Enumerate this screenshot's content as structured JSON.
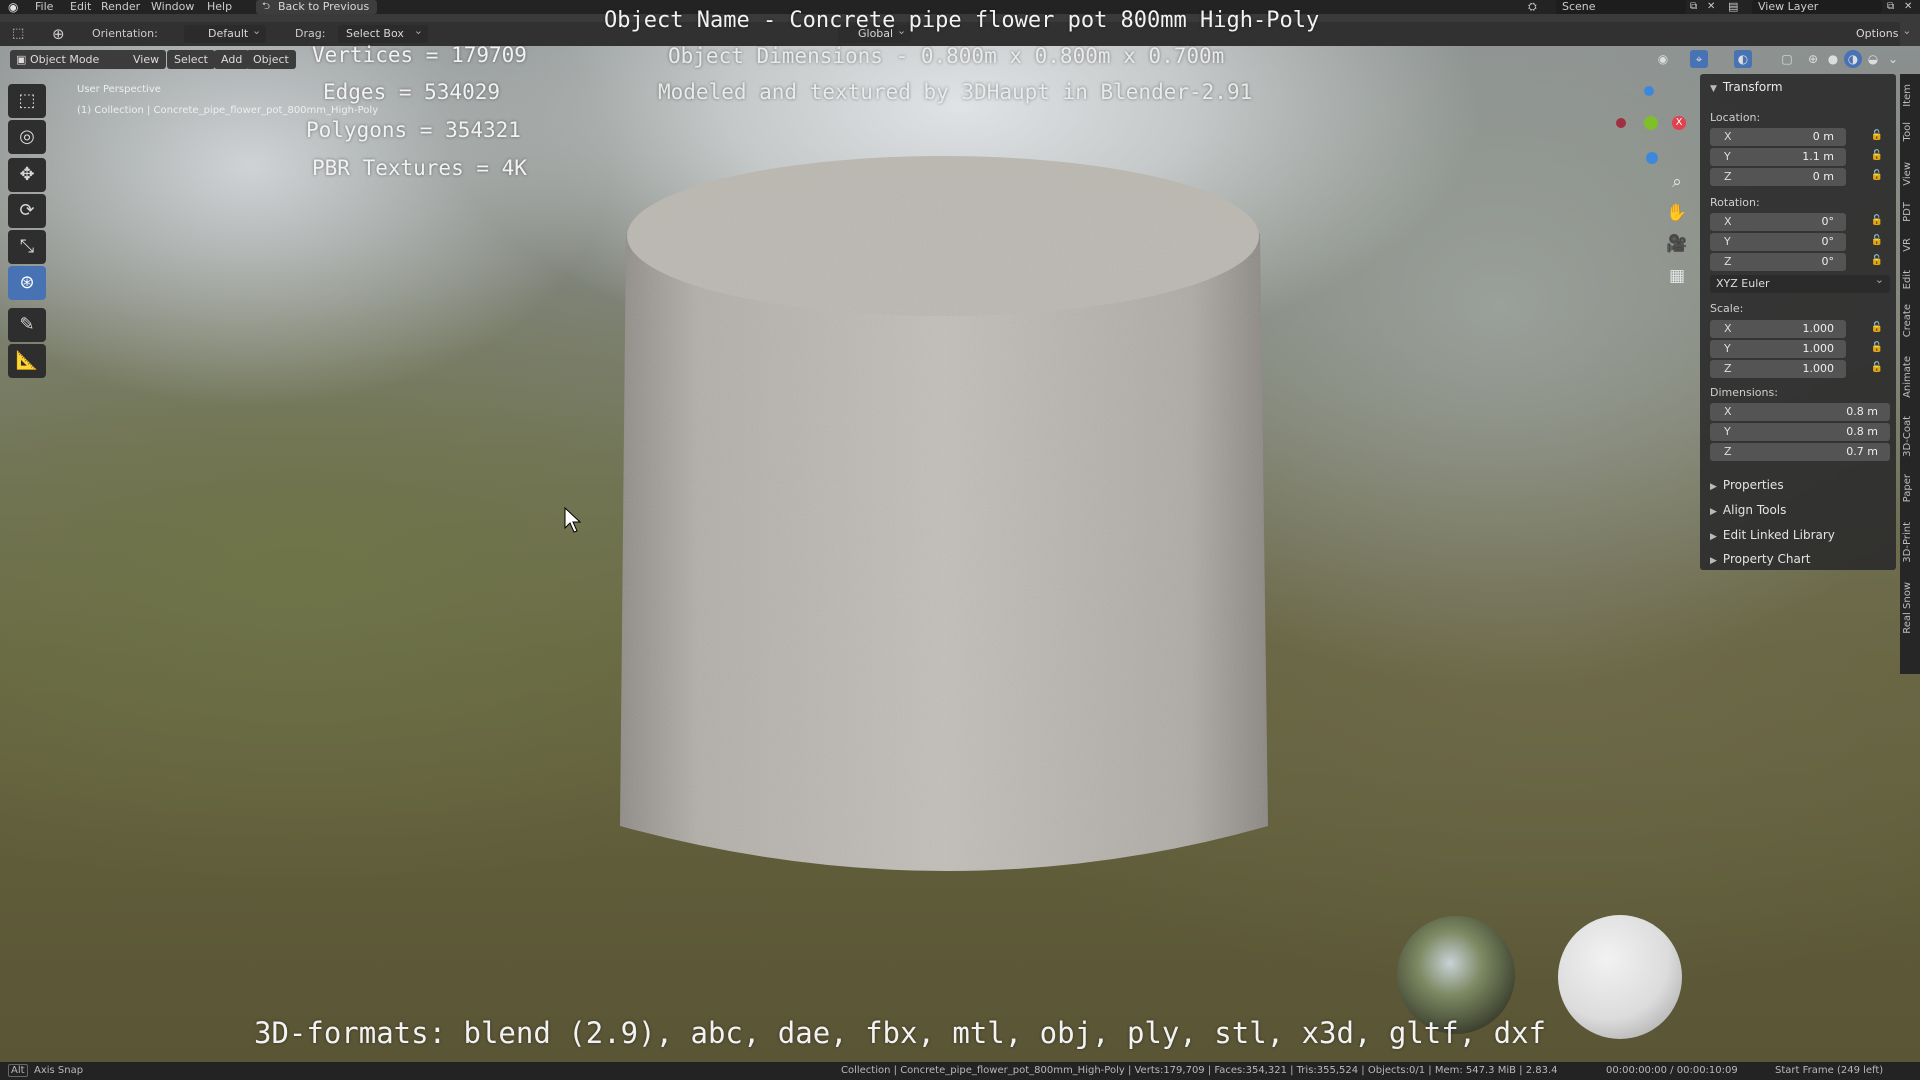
{
  "menubar": {
    "items": [
      "File",
      "Edit",
      "Render",
      "Window",
      "Help"
    ],
    "back_button": "Back to Previous",
    "scene": "Scene",
    "view_layer": "View Layer"
  },
  "toolheader": {
    "orientation_label": "Orientation:",
    "orientation_value": "Default",
    "drag_label": "Drag:",
    "drag_value": "Select Box",
    "transform_space": "Global",
    "options": "Options"
  },
  "viewport_header": {
    "mode": "Object Mode",
    "menus": [
      "View",
      "Select",
      "Add",
      "Object"
    ]
  },
  "viewport": {
    "perspective": "User Perspective",
    "collection_path": "(1) Collection | Concrete_pipe_flower_pot_800mm_High-Poly"
  },
  "overlay": {
    "title": "Object Name - Concrete pipe flower pot 800mm High-Poly",
    "dimensions": "Object Dimensions -  0.800m x 0.800m x 0.700m",
    "modeled_by": "Modeled and textured by 3DHaupt in Blender-2.91",
    "vertices": "Vertices = 179709",
    "edges": "Edges = 534029",
    "polygons": "Polygons = 354321",
    "textures": "PBR Textures = 4K",
    "formats": "3D-formats: blend (2.9), abc, dae, fbx, mtl, obj, ply, stl, x3d, gltf, dxf"
  },
  "npanel": {
    "transform_header": "Transform",
    "location_label": "Location:",
    "location": [
      {
        "axis": "X",
        "value": "0 m"
      },
      {
        "axis": "Y",
        "value": "1.1 m"
      },
      {
        "axis": "Z",
        "value": "0 m"
      }
    ],
    "rotation_label": "Rotation:",
    "rotation": [
      {
        "axis": "X",
        "value": "0°"
      },
      {
        "axis": "Y",
        "value": "0°"
      },
      {
        "axis": "Z",
        "value": "0°"
      }
    ],
    "rotation_mode": "XYZ Euler",
    "scale_label": "Scale:",
    "scale": [
      {
        "axis": "X",
        "value": "1.000"
      },
      {
        "axis": "Y",
        "value": "1.000"
      },
      {
        "axis": "Z",
        "value": "1.000"
      }
    ],
    "dimensions_label": "Dimensions:",
    "dimensions": [
      {
        "axis": "X",
        "value": "0.8 m"
      },
      {
        "axis": "Y",
        "value": "0.8 m"
      },
      {
        "axis": "Z",
        "value": "0.7 m"
      }
    ],
    "collapsed_panels": [
      "Properties",
      "Align Tools",
      "Edit Linked Library",
      "Property Chart"
    ]
  },
  "vertical_tabs": [
    "Item",
    "Tool",
    "View",
    "PDT",
    "VR",
    "Edit",
    "Create",
    "Animate",
    "3D-Coat",
    "Paper",
    "3D-Print",
    "Real Snow"
  ],
  "statusbar": {
    "key_hint": "Alt",
    "left_text": "Axis Snap",
    "info": "Collection | Concrete_pipe_flower_pot_800mm_High-Poly | Verts:179,709 | Faces:354,321 | Tris:355,524 | Objects:0/1 | Mem: 547.3 MiB | 2.83.4",
    "time": "00:00:00:00 / 00:00:10:09",
    "frame": "Start Frame (249 left)"
  },
  "colors": {
    "accent": "#4772b3",
    "axis_x": "#e2404e",
    "axis_y": "#7fbf2a",
    "axis_z": "#3e88dc"
  }
}
